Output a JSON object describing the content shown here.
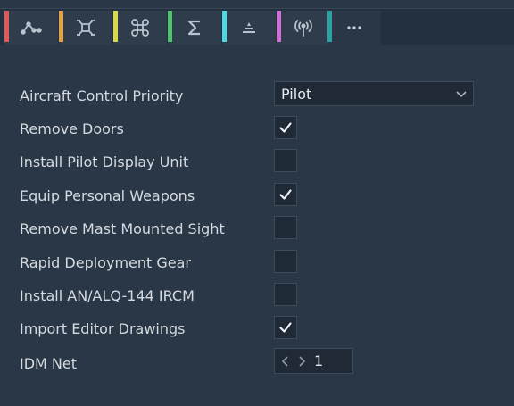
{
  "tabs": [
    {
      "icon": "waypoint-path-icon",
      "color": "#e05a5a"
    },
    {
      "icon": "drone-icon",
      "color": "#e3a245"
    },
    {
      "icon": "command-key-icon",
      "color": "#d8d84a"
    },
    {
      "icon": "sigma-icon",
      "color": "#4fc46a"
    },
    {
      "icon": "layers-icon",
      "color": "#4fd8e3"
    },
    {
      "icon": "radio-antenna-icon",
      "color": "#d070d8"
    },
    {
      "icon": "more-options-icon",
      "color": "#2aa3a3",
      "active": true
    }
  ],
  "settings": {
    "aircraft_control_priority": {
      "label": "Aircraft Control Priority",
      "value": "Pilot"
    },
    "remove_doors": {
      "label": "Remove Doors",
      "checked": true
    },
    "install_pilot_display_unit": {
      "label": "Install Pilot Display Unit",
      "checked": false
    },
    "equip_personal_weapons": {
      "label": "Equip Personal Weapons",
      "checked": true
    },
    "remove_mast_mounted_sight": {
      "label": "Remove Mast Mounted Sight",
      "checked": false
    },
    "rapid_deployment_gear": {
      "label": "Rapid Deployment Gear",
      "checked": false
    },
    "install_an_alq_144_ircm": {
      "label": "Install AN/ALQ-144 IRCM",
      "checked": false
    },
    "import_editor_drawings": {
      "label": "Import Editor Drawings",
      "checked": true
    },
    "idm_net": {
      "label": "IDM Net",
      "value": "1"
    }
  }
}
